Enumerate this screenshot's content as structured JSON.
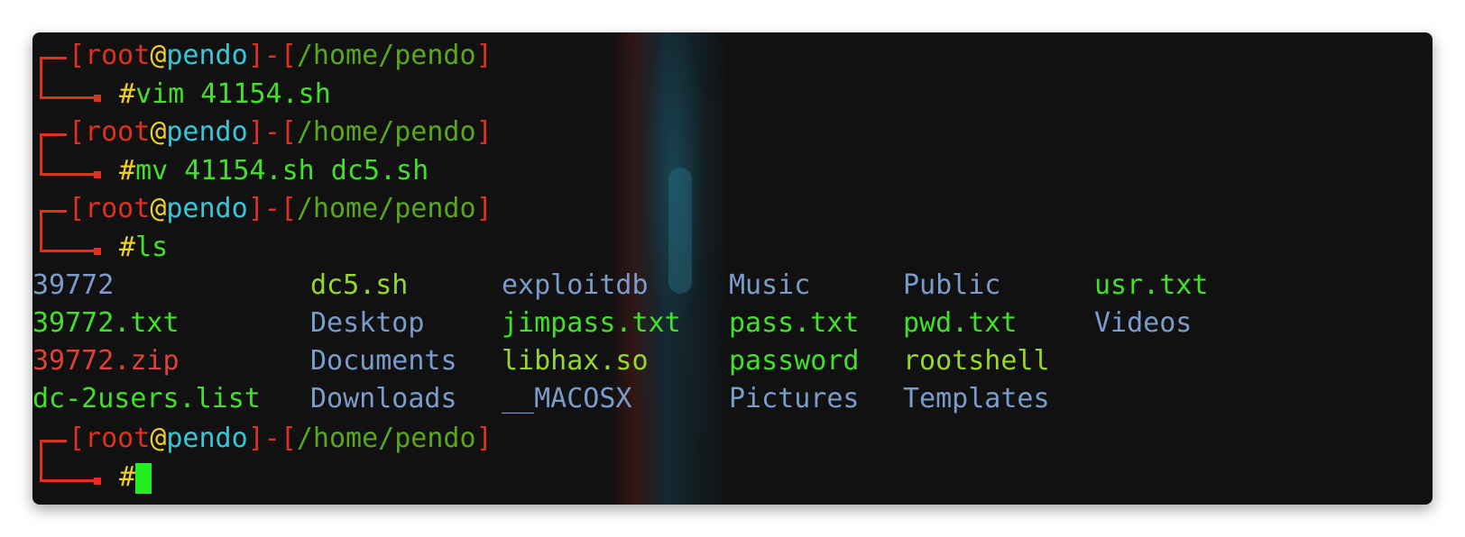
{
  "prompt": {
    "user": "root",
    "at": "@",
    "host": "pendo",
    "path": "/home/pendo",
    "open_bracket": "[",
    "close_bracket": "]",
    "dash": "-",
    "hash": "#"
  },
  "commands": [
    "vim 41154.sh",
    "mv 41154.sh dc5.sh",
    "ls",
    ""
  ],
  "ls_output": {
    "rows": [
      [
        {
          "name": "39772",
          "color": "blue"
        },
        {
          "name": "dc5.sh",
          "color": "lime"
        },
        {
          "name": "exploitdb",
          "color": "blue"
        },
        {
          "name": "Music",
          "color": "blue"
        },
        {
          "name": "Public",
          "color": "blue"
        },
        {
          "name": "usr.txt",
          "color": "green"
        }
      ],
      [
        {
          "name": "39772.txt",
          "color": "green"
        },
        {
          "name": "Desktop",
          "color": "blue"
        },
        {
          "name": "jimpass.txt",
          "color": "green"
        },
        {
          "name": "pass.txt",
          "color": "green"
        },
        {
          "name": "pwd.txt",
          "color": "green"
        },
        {
          "name": "Videos",
          "color": "blue"
        }
      ],
      [
        {
          "name": "39772.zip",
          "color": "red"
        },
        {
          "name": "Documents",
          "color": "blue"
        },
        {
          "name": "libhax.so",
          "color": "lime"
        },
        {
          "name": "password",
          "color": "green"
        },
        {
          "name": "rootshell",
          "color": "lime"
        },
        {
          "name": "",
          "color": "blue"
        }
      ],
      [
        {
          "name": "dc-2users.list",
          "color": "green"
        },
        {
          "name": "Downloads",
          "color": "blue"
        },
        {
          "name": "__MACOSX",
          "color": "blue"
        },
        {
          "name": "Pictures",
          "color": "blue"
        },
        {
          "name": "Templates",
          "color": "blue"
        },
        {
          "name": "",
          "color": "blue"
        }
      ]
    ]
  },
  "colors": {
    "background": "#111111",
    "prompt_red": "#e0301e",
    "host_cyan": "#35c8d8",
    "path_green": "#58a81c",
    "hash_yellow": "#f0d020",
    "command_green": "#42e02a",
    "dir_blue": "#7a9ccc",
    "cursor": "#22ee22"
  }
}
